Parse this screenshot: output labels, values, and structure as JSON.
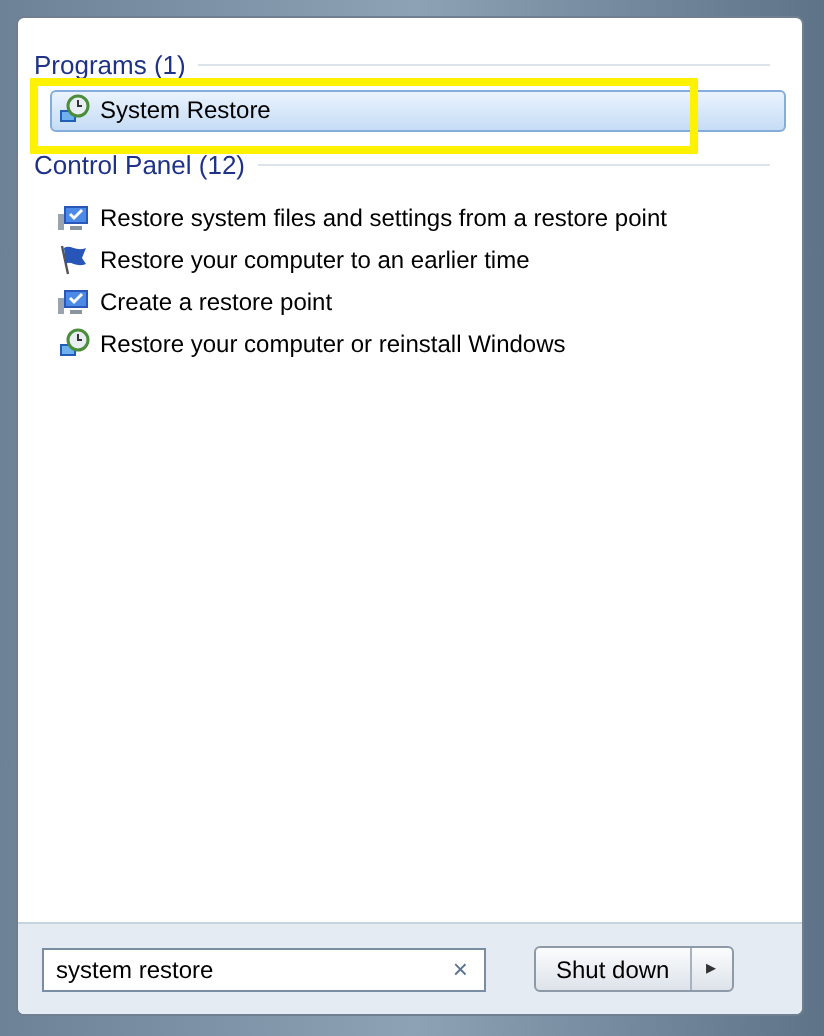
{
  "groups": [
    {
      "heading": "Programs (1)",
      "items": [
        {
          "label": "System Restore",
          "kind": "restore",
          "selected": true
        }
      ]
    },
    {
      "heading": "Control Panel (12)",
      "items": [
        {
          "label": "Restore system files and settings from a restore point",
          "kind": "monitor",
          "selected": false
        },
        {
          "label": "Restore your computer to an earlier time",
          "kind": "flag",
          "selected": false
        },
        {
          "label": "Create a restore point",
          "kind": "monitor",
          "selected": false
        },
        {
          "label": "Restore your computer or reinstall Windows",
          "kind": "restore",
          "selected": false
        }
      ]
    }
  ],
  "search": {
    "value": "system restore",
    "clear": "×"
  },
  "shutdown": {
    "label": "Shut down",
    "arrow": "▸"
  }
}
